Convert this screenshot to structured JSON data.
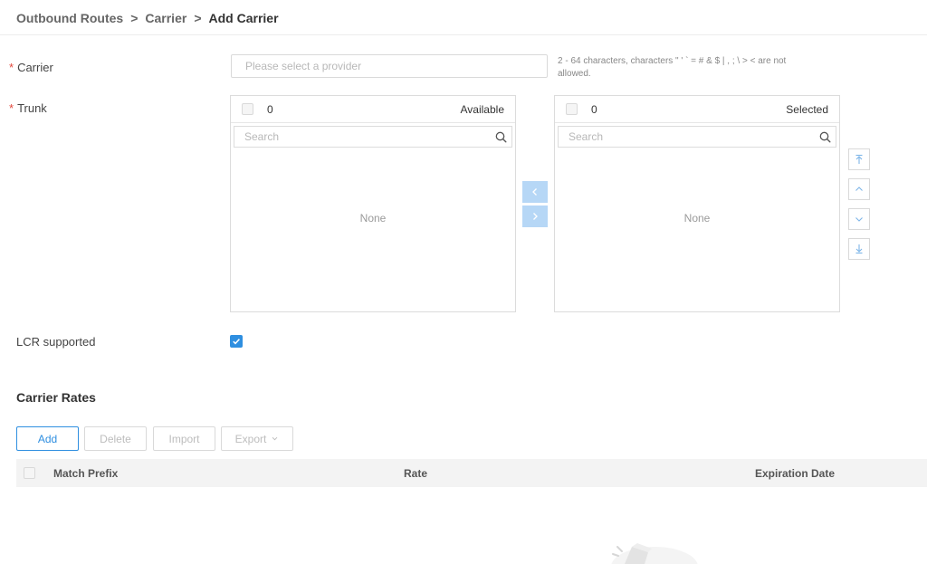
{
  "breadcrumb": {
    "items": [
      "Outbound Routes",
      "Carrier",
      "Add Carrier"
    ],
    "separator": ">"
  },
  "form": {
    "carrier": {
      "label": "Carrier",
      "required_mark": "*",
      "placeholder": "Please select a provider",
      "value": "",
      "hint": "2 - 64 characters, characters \" ' ` = # & $ | , ; \\ > < are not allowed."
    },
    "trunk": {
      "label": "Trunk",
      "required_mark": "*",
      "available": {
        "count": "0",
        "title": "Available",
        "search_placeholder": "Search",
        "empty_text": "None"
      },
      "selected": {
        "count": "0",
        "title": "Selected",
        "search_placeholder": "Search",
        "empty_text": "None"
      }
    },
    "lcr": {
      "label": "LCR supported",
      "checked": true
    }
  },
  "rates": {
    "section_title": "Carrier Rates",
    "toolbar": {
      "add_label": "Add",
      "delete_label": "Delete",
      "import_label": "Import",
      "export_label": "Export"
    },
    "columns": [
      "Match Prefix",
      "Rate",
      "Expiration Date"
    ],
    "rows": []
  },
  "icons": {
    "search": "search-icon",
    "transfer_left": "chevron-left-icon",
    "transfer_right": "chevron-right-icon",
    "move_top": "move-to-top-icon",
    "move_up": "chevron-up-icon",
    "move_down": "chevron-down-icon",
    "move_bottom": "move-to-bottom-icon",
    "checkbox_checked": "check-icon",
    "export_dropdown": "chevron-down-icon"
  },
  "colors": {
    "primary": "#2f8fe0",
    "required": "#e2483d",
    "transfer_button": "#b6d7f6",
    "table_header_bg": "#f3f3f3"
  }
}
